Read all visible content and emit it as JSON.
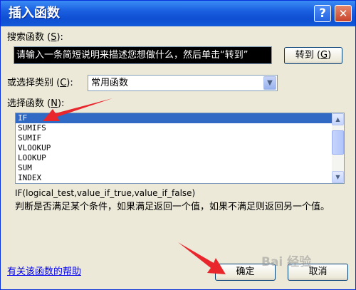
{
  "window": {
    "title": "插入函数"
  },
  "titlebar": {
    "help_glyph": "?",
    "close_glyph": "✕"
  },
  "search": {
    "label_prefix": "搜索函数 (",
    "label_key": "S",
    "label_suffix": "):",
    "value": "请输入一条简短说明来描述您想做什么，然后单击“转到”",
    "go_prefix": "转到 (",
    "go_key": "G",
    "go_suffix": ")"
  },
  "category": {
    "label_prefix": "或选择类别 (",
    "label_key": "C",
    "label_suffix": "):",
    "selected": "常用函数"
  },
  "functions": {
    "label_prefix": "选择函数 (",
    "label_key": "N",
    "label_suffix": "):",
    "items": [
      "IF",
      "SUMIFS",
      "SUMIF",
      "VLOOKUP",
      "LOOKUP",
      "SUM",
      "INDEX"
    ],
    "selected_index": 0
  },
  "syntax": "IF(logical_test,value_if_true,value_if_false)",
  "description": "判断是否满足某个条件，如果满足返回一个值，如果不满足则返回另一个值。",
  "footer": {
    "help_link": "有关该函数的帮助",
    "ok_label": "确定",
    "cancel_label": "取消"
  },
  "watermark": "Bai 经验",
  "colors": {
    "annotation_arrow": "#e8262c",
    "selection": "#316ac5",
    "titlebar": "#0f4fd3"
  }
}
